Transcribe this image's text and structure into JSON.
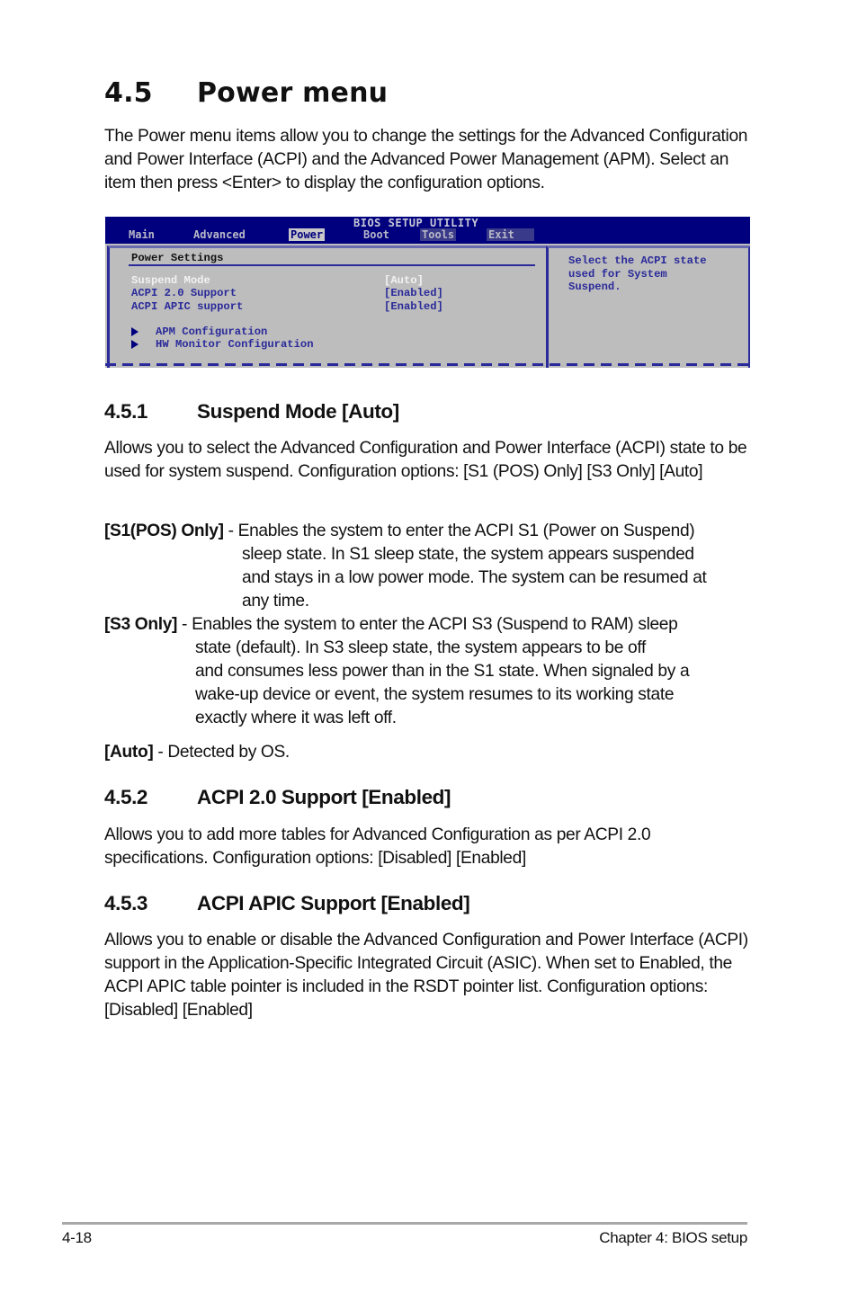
{
  "section": {
    "number": "4.5",
    "title": "Power menu",
    "intro": "The Power menu items allow you to change the settings for the Advanced Configuration and Power Interface (ACPI) and the Advanced Power Management (APM). Select an item then press <Enter> to display the configuration options."
  },
  "bios": {
    "title": "BIOS SETUP UTILITY",
    "tabs": [
      "Main",
      "Advanced",
      "Power",
      "Boot",
      "Tools",
      "Exit"
    ],
    "active_tab": "Power",
    "section_header": "Power Settings",
    "items": [
      {
        "label": "Suspend Mode",
        "value": "[Auto]",
        "selected": true
      },
      {
        "label": "ACPI 2.0 Support",
        "value": "[Enabled]",
        "selected": false
      },
      {
        "label": "ACPI APIC support",
        "value": "[Enabled]",
        "selected": false
      }
    ],
    "submenus": [
      "APM Configuration",
      "HW Monitor Configuration"
    ],
    "help_lines": [
      "Select the ACPI state",
      "used for System",
      "Suspend."
    ],
    "colors": {
      "header_bg": "#00007f",
      "panel_bg": "#bdbdbd",
      "text": "#2a2a9a",
      "selected": "#f2f2f2"
    }
  },
  "subsections": [
    {
      "number": "4.5.1",
      "title": "Suspend Mode [Auto]",
      "body": "Allows you to select the Advanced Configuration and Power Interface (ACPI) state to be used for system suspend. Configuration options: [S1 (POS) Only] [S3 Only] [Auto]",
      "options": [
        {
          "term": "[S1(POS) Only]",
          "lines": [
            "Enables the system to enter the ACPI S1 (Power on Suspend)",
            "sleep state. In S1 sleep state, the system appears suspended",
            "and stays in a low power mode. The system can be resumed at",
            "any time."
          ]
        },
        {
          "term": "[S3 Only]",
          "lines": [
            "Enables the system to enter the ACPI S3 (Suspend to RAM) sleep",
            "state (default). In S3 sleep state, the system appears to be off",
            "and consumes less power than in the S1 state. When signaled by a",
            "wake-up device or event, the system resumes to its working state",
            "exactly where it was left off."
          ]
        },
        {
          "term": "[Auto]",
          "lines": [
            "Detected by OS."
          ]
        }
      ]
    },
    {
      "number": "4.5.2",
      "title": "ACPI 2.0 Support [Enabled]",
      "body": "Allows you to add more tables for Advanced Configuration as per ACPI 2.0 specifications. Configuration options: [Disabled] [Enabled]"
    },
    {
      "number": "4.5.3",
      "title": "ACPI APIC Support [Enabled]",
      "body": "Allows you to enable or disable the Advanced Configuration and Power Interface (ACPI) support in the Application-Specific Integrated Circuit (ASIC). When set to Enabled, the ACPI APIC table pointer is included in the RSDT pointer list. Configuration options: [Disabled] [Enabled]"
    }
  ],
  "footer": {
    "page": "4-18",
    "chapter": "Chapter 4: BIOS setup"
  }
}
